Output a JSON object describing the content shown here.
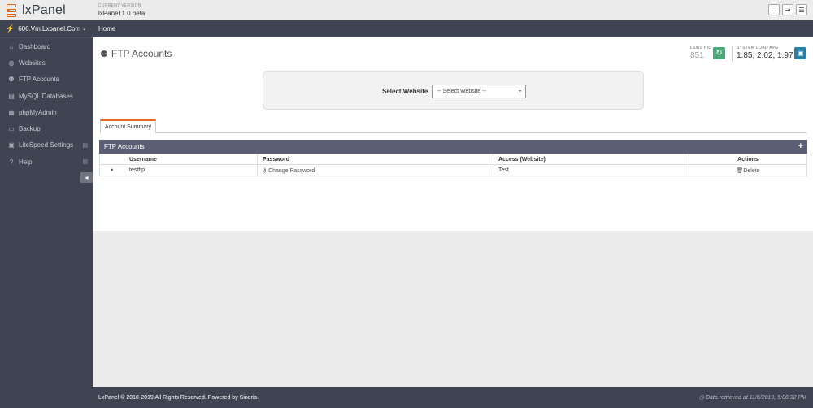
{
  "app": {
    "logo_text": "lxPanel",
    "version_label": "CURRENT VERSION",
    "version_value": "lxPanel 1.0 beta"
  },
  "top_actions": [
    {
      "icon": "fullscreen-icon",
      "glyph": "⛶"
    },
    {
      "icon": "logout-icon",
      "glyph": "⇥"
    },
    {
      "icon": "menu-icon",
      "glyph": "☰"
    }
  ],
  "sidebar": {
    "server_name": "606.Vm.Lxpanel.Com",
    "items": [
      {
        "label": "Dashboard",
        "icon": "home-icon",
        "glyph": "⌂",
        "expandable": false
      },
      {
        "label": "Websites",
        "icon": "globe-icon",
        "glyph": "◍",
        "expandable": false
      },
      {
        "label": "FTP Accounts",
        "icon": "users-icon",
        "glyph": "👥",
        "expandable": false
      },
      {
        "label": "MySQL Databases",
        "icon": "database-icon",
        "glyph": "▤",
        "expandable": false
      },
      {
        "label": "phpMyAdmin",
        "icon": "table-icon",
        "glyph": "▦",
        "expandable": false
      },
      {
        "label": "Backup",
        "icon": "backup-icon",
        "glyph": "▭",
        "expandable": false
      },
      {
        "label": "LiteSpeed Settings",
        "icon": "settings-icon",
        "glyph": "▣",
        "expandable": true
      },
      {
        "label": "Help",
        "icon": "help-icon",
        "glyph": "?",
        "expandable": true
      }
    ]
  },
  "breadcrumb": {
    "home": "Home"
  },
  "page": {
    "title": "FTP Accounts",
    "lsws_label": "LSWS PID",
    "lsws_value": "851",
    "load_label": "SYSTEM LOAD AVG",
    "load_value": "1.85, 2.02, 1.97"
  },
  "select_website": {
    "label": "Select Website",
    "value": "-- Select Website --"
  },
  "tabs": [
    {
      "label": "Account Summary"
    }
  ],
  "ftp_panel": {
    "title": "FTP Accounts",
    "columns": [
      "",
      "Username",
      "Password",
      "Access (Website)",
      "Actions"
    ],
    "rows": [
      {
        "username": "testftp",
        "password_action": "Change Password",
        "access": "Test",
        "action": "Delete"
      }
    ]
  },
  "footer": {
    "copyright": "LxPanel © 2018-2019 All Rights Reserved. Powered by Sineris.",
    "retrieved": "Data retrieved at 11/6/2019, 5:06:32 PM"
  }
}
